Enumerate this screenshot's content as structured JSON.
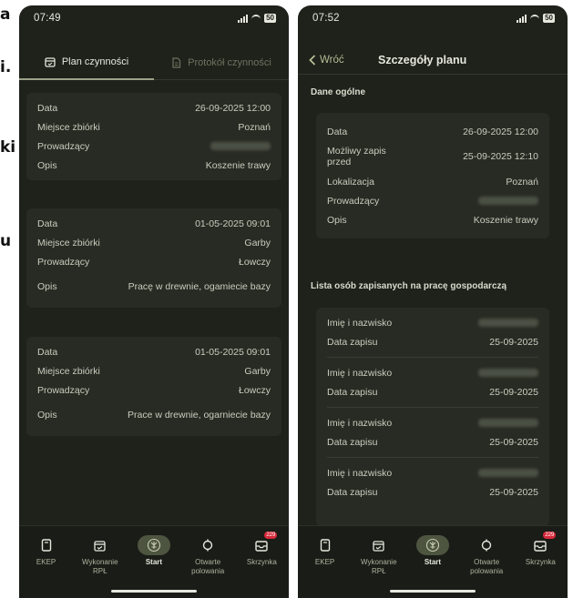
{
  "edge_fragments": [
    "a",
    "i.",
    "ki",
    "u"
  ],
  "left": {
    "time": "07:49",
    "battery": "50",
    "tabs": [
      {
        "label": "Plan czynności",
        "active": true
      },
      {
        "label": "Protokół czynności",
        "active": false
      }
    ],
    "cards": [
      {
        "rows": [
          {
            "label": "Data",
            "value": "26-09-2025 12:00"
          },
          {
            "label": "Miejsce zbiórki",
            "value": "Poznań"
          },
          {
            "label": "Prowadzący",
            "value": ""
          },
          {
            "label": "Opis",
            "value": "Koszenie trawy"
          }
        ]
      },
      {
        "rows": [
          {
            "label": "Data",
            "value": "01-05-2025 09:01"
          },
          {
            "label": "Miejsce zbiórki",
            "value": "Garby"
          },
          {
            "label": "Prowadzący",
            "value": "Łowczy"
          },
          {
            "label": "Opis",
            "value": "Pracę w drewnie, ogamiecie bazy"
          }
        ]
      },
      {
        "rows": [
          {
            "label": "Data",
            "value": "01-05-2025 09:01"
          },
          {
            "label": "Miejsce zbiórki",
            "value": "Garby"
          },
          {
            "label": "Prowadzący",
            "value": "Łowczy"
          },
          {
            "label": "Opis",
            "value": "Prace w drewnie, ogarniecie bazy"
          }
        ]
      }
    ]
  },
  "right": {
    "time": "07:52",
    "battery": "50",
    "back_label": "Wróć",
    "title": "Szczegóły planu",
    "general_title": "Dane ogólne",
    "general_rows": [
      {
        "label": "Data",
        "value": "26-09-2025 12:00"
      },
      {
        "label": "Możliwy zapis przed",
        "value": "25-09-2025 12:10"
      },
      {
        "label": "Lokalizacja",
        "value": "Poznań"
      },
      {
        "label": "Prowadzący",
        "value": ""
      },
      {
        "label": "Opis",
        "value": "Koszenie trawy"
      }
    ],
    "list_title": "Lista osób zapisanych na pracę gospodarczą",
    "persons": [
      {
        "name_label": "Imię i nazwisko",
        "date_label": "Data zapisu",
        "date": "25-09-2025"
      },
      {
        "name_label": "Imię i nazwisko",
        "date_label": "Data zapisu",
        "date": "25-09-2025"
      },
      {
        "name_label": "Imię i nazwisko",
        "date_label": "Data zapisu",
        "date": "25-09-2025"
      },
      {
        "name_label": "Imię i nazwisko",
        "date_label": "Data zapisu",
        "date": "25-09-2025"
      }
    ]
  },
  "bottom_nav": [
    {
      "label": "EKEP",
      "icon": "book-icon",
      "active": false
    },
    {
      "label": "Wykonanie RPŁ",
      "icon": "calendar-check-icon",
      "active": false
    },
    {
      "label": "Start",
      "icon": "deer-emblem-icon",
      "active": true
    },
    {
      "label": "Otwarte polowania",
      "icon": "crosshair-icon",
      "active": false
    },
    {
      "label": "Skrzynka",
      "icon": "inbox-icon",
      "active": false,
      "badge": "229"
    }
  ],
  "colors": {
    "background": "#1f211b",
    "card": "#282b24",
    "accent": "#b4bf94",
    "badge": "#d6293a"
  }
}
